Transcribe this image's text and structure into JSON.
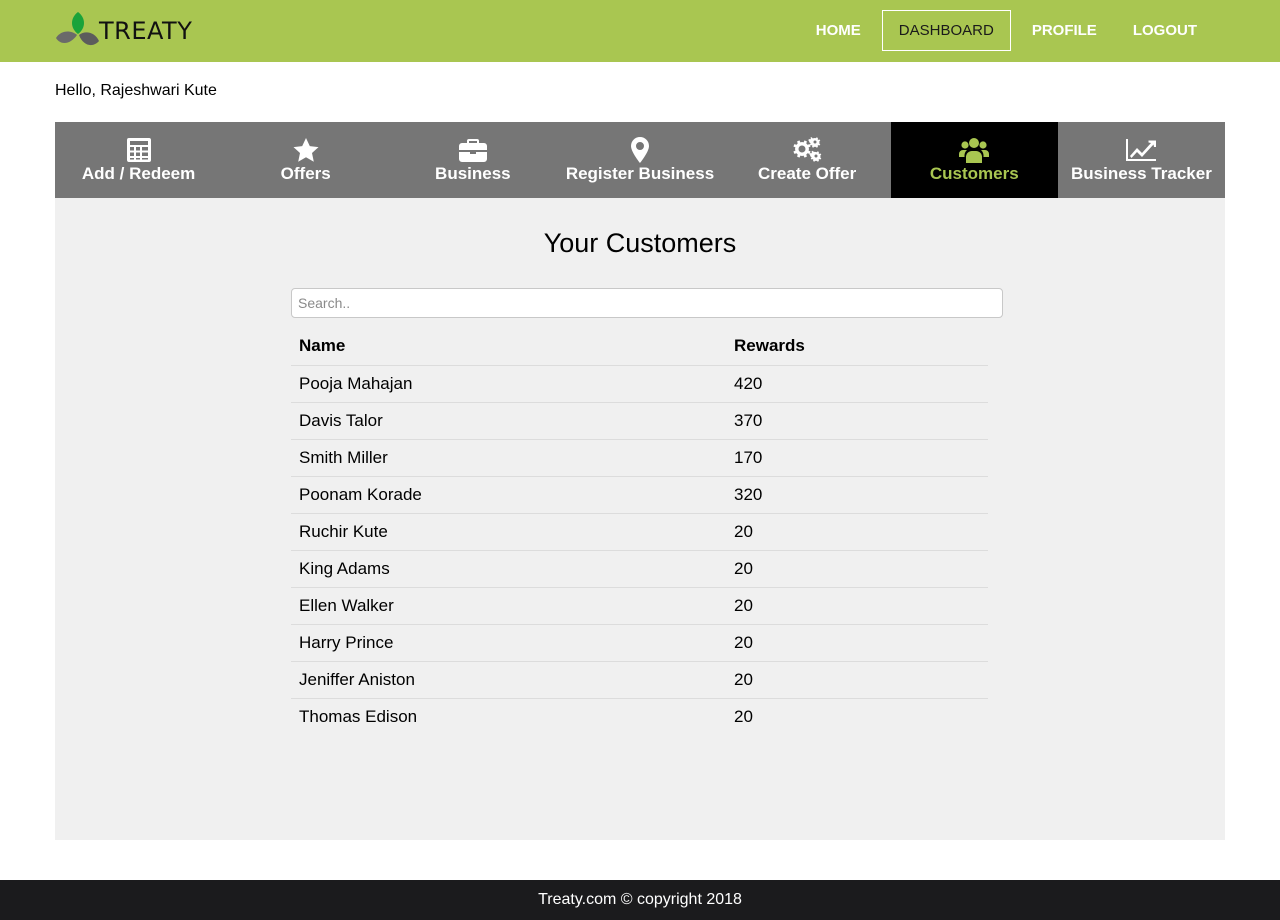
{
  "brand": {
    "name": "TREATY",
    "colors": {
      "accent": "#a9c651",
      "tabs_bg": "#767676",
      "active_tab_bg": "#000000",
      "footer_bg": "#1b1b1d"
    }
  },
  "nav": {
    "items": [
      {
        "label": "HOME",
        "active": false
      },
      {
        "label": "DASHBOARD",
        "active": true
      },
      {
        "label": "PROFILE",
        "active": false
      },
      {
        "label": "LOGOUT",
        "active": false
      }
    ]
  },
  "greeting": "Hello, Rajeshwari Kute",
  "tabs": [
    {
      "label": "Add / Redeem",
      "icon": "calculator-icon",
      "active": false
    },
    {
      "label": "Offers",
      "icon": "star-icon",
      "active": false
    },
    {
      "label": "Business",
      "icon": "briefcase-icon",
      "active": false
    },
    {
      "label": "Register Business",
      "icon": "map-marker-icon",
      "active": false
    },
    {
      "label": "Create Offer",
      "icon": "gears-icon",
      "active": false
    },
    {
      "label": "Customers",
      "icon": "users-icon",
      "active": true
    },
    {
      "label": "Business Tracker",
      "icon": "line-chart-icon",
      "active": false
    }
  ],
  "main": {
    "title": "Your Customers",
    "search": {
      "placeholder": "Search..",
      "value": ""
    },
    "table": {
      "headers": [
        "Name",
        "Rewards"
      ],
      "rows": [
        [
          "Pooja Mahajan",
          "420"
        ],
        [
          "Davis Talor",
          "370"
        ],
        [
          "Smith Miller",
          "170"
        ],
        [
          "Poonam Korade",
          "320"
        ],
        [
          "Ruchir Kute",
          "20"
        ],
        [
          "King Adams",
          "20"
        ],
        [
          "Ellen Walker",
          "20"
        ],
        [
          "Harry Prince",
          "20"
        ],
        [
          "Jeniffer Aniston",
          "20"
        ],
        [
          "Thomas Edison",
          "20"
        ]
      ]
    }
  },
  "footer": {
    "text": "Treaty.com © copyright 2018"
  }
}
